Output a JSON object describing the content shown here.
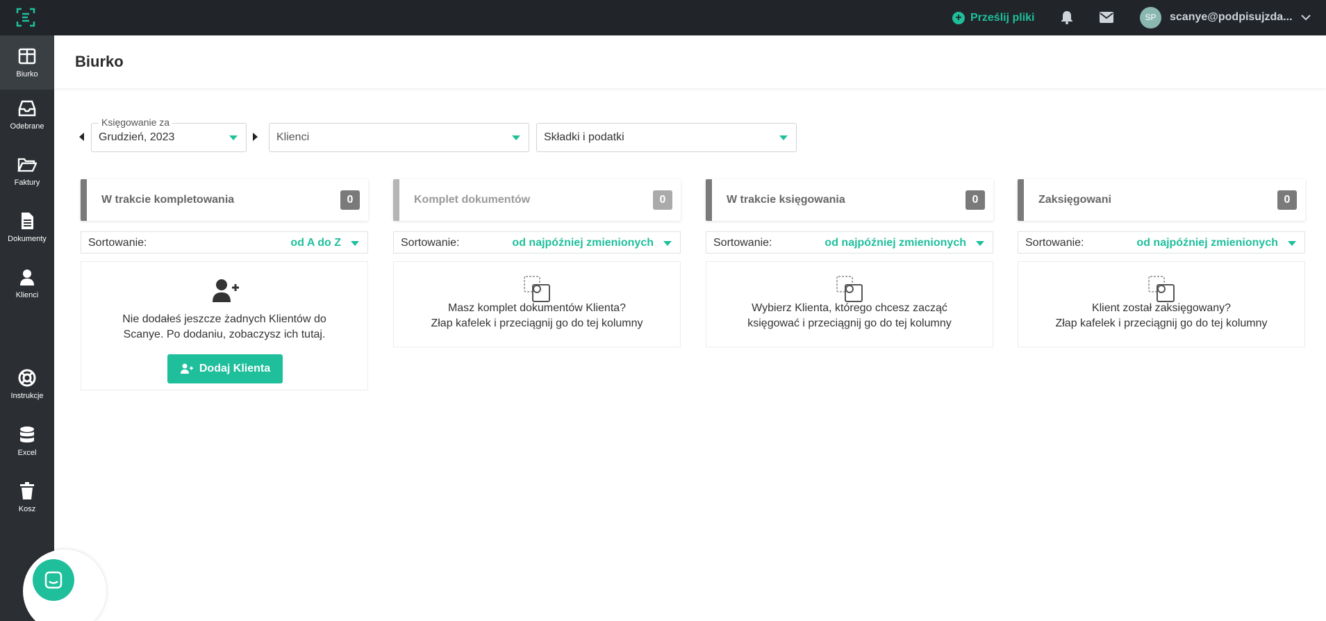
{
  "topbar": {
    "upload_label": "Prześlij pliki",
    "avatar_initials": "SP",
    "user_email": "scanye@podpisujzda..."
  },
  "sidebar": {
    "items": [
      {
        "label": "Biurko",
        "icon": "desk-icon"
      },
      {
        "label": "Odebrane",
        "icon": "inbox-icon"
      },
      {
        "label": "Faktury",
        "icon": "folder-icon"
      },
      {
        "label": "Dokumenty",
        "icon": "document-icon"
      },
      {
        "label": "Klienci",
        "icon": "user-icon"
      },
      {
        "label": "Instrukcje",
        "icon": "lifebuoy-icon"
      },
      {
        "label": "Excel",
        "icon": "database-icon"
      },
      {
        "label": "Kosz",
        "icon": "trash-icon"
      }
    ]
  },
  "page": {
    "title": "Biurko"
  },
  "filters": {
    "period_legend": "Księgowanie za",
    "period_value": "Grudzień, 2023",
    "clients_placeholder": "Klienci",
    "taxes_value": "Składki i podatki"
  },
  "columns": [
    {
      "title": "W trakcie kompletowania",
      "count": "0",
      "sort_label": "Sortowanie:",
      "sort_value": "od A do Z",
      "empty_text_1": "Nie dodałeś jeszcze żadnych Klientów do",
      "empty_text_2": "Scanye. Po dodaniu, zobaczysz ich tutaj.",
      "button_label": "Dodaj Klienta"
    },
    {
      "title": "Komplet dokumentów",
      "count": "0",
      "sort_label": "Sortowanie:",
      "sort_value": "od najpóźniej zmienionych",
      "empty_text_1": "Masz komplet dokumentów Klienta?",
      "empty_text_2": "Złap kafelek i przeciągnij go do tej kolumny"
    },
    {
      "title": "W trakcie księgowania",
      "count": "0",
      "sort_label": "Sortowanie:",
      "sort_value": "od najpóźniej zmienionych",
      "empty_text_1": "Wybierz Klienta, którego chcesz zacząć",
      "empty_text_2": "księgować i przeciągnij go do tej kolumny"
    },
    {
      "title": "Zaksięgowani",
      "count": "0",
      "sort_label": "Sortowanie:",
      "sort_value": "od najpóźniej zmienionych",
      "empty_text_1": "Klient został zaksięgowany?",
      "empty_text_2": "Złap kafelek i przeciągnij go do tej kolumny"
    }
  ],
  "colors": {
    "accent": "#1fbf9c",
    "topbar": "#212529",
    "sidebar": "#2b2f33"
  }
}
